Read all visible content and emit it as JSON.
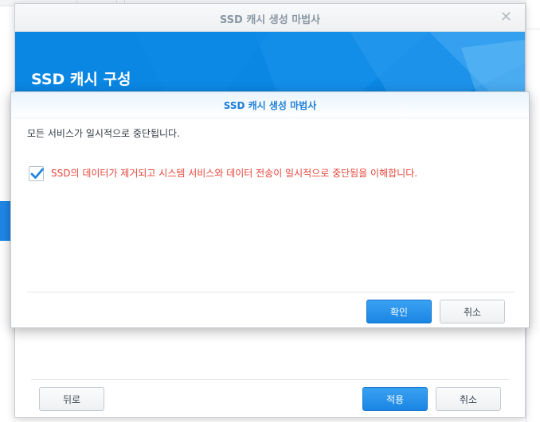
{
  "wizard": {
    "title": "SSD 캐시 생성 마법사",
    "close_icon": "close-icon",
    "heading": "SSD 캐시 구성",
    "back_label": "뒤로",
    "apply_label": "적용",
    "cancel_label": "취소",
    "accent_color": "#0a86e3"
  },
  "dialog": {
    "title": "SSD 캐시 생성 마법사",
    "message": "모든 서비스가 일시적으로 중단됩니다.",
    "checkbox": {
      "checked": true,
      "label": "SSD의 데이터가 제거되고 시스템 서비스와 데이터 전송이 일시적으로 중단됨을 이해합니다.",
      "label_color": "#e6453a"
    },
    "ok_label": "확인",
    "cancel_label": "취소"
  }
}
